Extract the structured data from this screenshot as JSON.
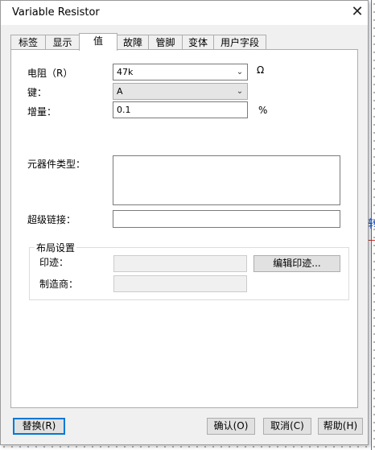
{
  "window": {
    "title": "Variable Resistor",
    "close_glyph": "✕"
  },
  "tabs": [
    {
      "label": "标签"
    },
    {
      "label": "显示"
    },
    {
      "label": "值",
      "active": true
    },
    {
      "label": "故障"
    },
    {
      "label": "管脚"
    },
    {
      "label": "变体"
    },
    {
      "label": "用户字段"
    }
  ],
  "value_tab": {
    "resistance": {
      "label": "电阻（R）",
      "value": "47k",
      "unit": "Ω"
    },
    "key": {
      "label": "键：",
      "value": "A"
    },
    "increment": {
      "label": "增量：",
      "value": "0.1",
      "unit": "%"
    },
    "component_type": {
      "label": "元器件类型：",
      "value": ""
    },
    "hyperlink": {
      "label": "超级链接：",
      "value": ""
    },
    "layout": {
      "title": "布局设置",
      "footprint_label": "印迹：",
      "footprint_value": "",
      "edit_footprint_button": "编辑印迹...",
      "manufacturer_label": "制造商：",
      "manufacturer_value": ""
    }
  },
  "footer": {
    "replace_button": "替换(R)",
    "ok_button": "确认(O)",
    "cancel_button": "取消(C)",
    "help_button": "帮助(H)"
  },
  "colors": {
    "accent": "#0078d7",
    "dialog_bg": "#f0f0f0",
    "panel_bg": "#ffffff"
  }
}
